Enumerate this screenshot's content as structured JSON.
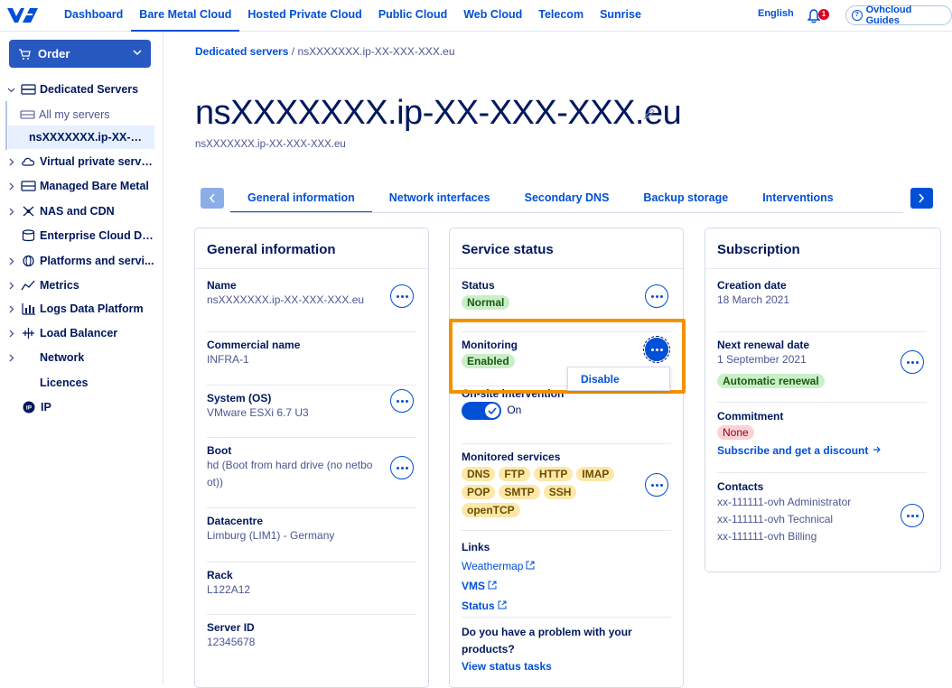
{
  "topnav": {
    "items": [
      "Dashboard",
      "Bare Metal Cloud",
      "Hosted Private Cloud",
      "Public Cloud",
      "Web Cloud",
      "Telecom",
      "Sunrise"
    ],
    "language": "English",
    "notifications_count": "1",
    "guides": "Ovhcloud Guides"
  },
  "sidebar": {
    "order": "Order",
    "dedicated_servers": "Dedicated Servers",
    "all_my_servers": "All my servers",
    "selected_server": "nsXXXXXXX.ip-XX-XXX-...",
    "items": [
      "Virtual private servers",
      "Managed Bare Metal",
      "NAS and CDN",
      "Enterprise Cloud Da...",
      "Platforms and servi...",
      "Metrics",
      "Logs Data Platform",
      "Load Balancer",
      "Network",
      "Licences",
      "IP"
    ]
  },
  "breadcrumb": {
    "parent": "Dedicated servers",
    "separator": "/",
    "current": "nsXXXXXXX.ip-XX-XXX-XXX.eu"
  },
  "page": {
    "title": "nsXXXXXXX.ip-XX-XXX-XXX.eu",
    "subtitle": "nsXXXXXXX.ip-XX-XXX-XXX.eu"
  },
  "tabs": [
    "General information",
    "Network interfaces",
    "Secondary DNS",
    "Backup storage",
    "Interventions"
  ],
  "general": {
    "title": "General information",
    "name_label": "Name",
    "name_value": "nsXXXXXXX.ip-XX-XXX-XXX.eu",
    "commercial_label": "Commercial name",
    "commercial_value": "INFRA-1",
    "os_label": "System (OS)",
    "os_value": "VMware ESXi 6.7 U3",
    "boot_label": "Boot",
    "boot_value_1": "hd (Boot from hard drive (no netbo",
    "boot_value_2": "ot))",
    "dc_label": "Datacentre",
    "dc_value": "Limburg (LIM1) - Germany",
    "rack_label": "Rack",
    "rack_value": "L122A12",
    "sid_label": "Server ID",
    "sid_value": "12345678"
  },
  "service": {
    "title": "Service status",
    "status_label": "Status",
    "status_value": "Normal",
    "monitoring_label": "Monitoring",
    "monitoring_value": "Enabled",
    "disable_action": "Disable",
    "onsite_label": "On-site intervention",
    "onsite_toggle": "On",
    "monitored_label": "Monitored services",
    "services": [
      "DNS",
      "FTP",
      "HTTP",
      "IMAP",
      "POP",
      "SMTP",
      "SSH",
      "openTCP"
    ],
    "links_label": "Links",
    "links": [
      "Weathermap",
      "VMS",
      "Status"
    ],
    "problem_1": "Do you have a problem with your",
    "problem_2": "products?",
    "view_tasks": "View status tasks"
  },
  "subscription": {
    "title": "Subscription",
    "creation_label": "Creation date",
    "creation_value": "18 March 2021",
    "renewal_label": "Next renewal date",
    "renewal_value": "1 September 2021",
    "renewal_badge": "Automatic renewal",
    "commitment_label": "Commitment",
    "commitment_value": "None",
    "subscribe_link": "Subscribe and get a discount",
    "contacts_label": "Contacts",
    "contacts": [
      "xx-111111-ovh Administrator",
      "xx-111111-ovh Technical",
      "xx-111111-ovh Billing"
    ]
  },
  "colors": {
    "primary": "#0050d7",
    "dark_text": "#00185e",
    "highlight": "#f39100",
    "success_bg": "#c9efc8",
    "warning_bg": "#fde8a8",
    "error_bg": "#fbd3d6"
  }
}
